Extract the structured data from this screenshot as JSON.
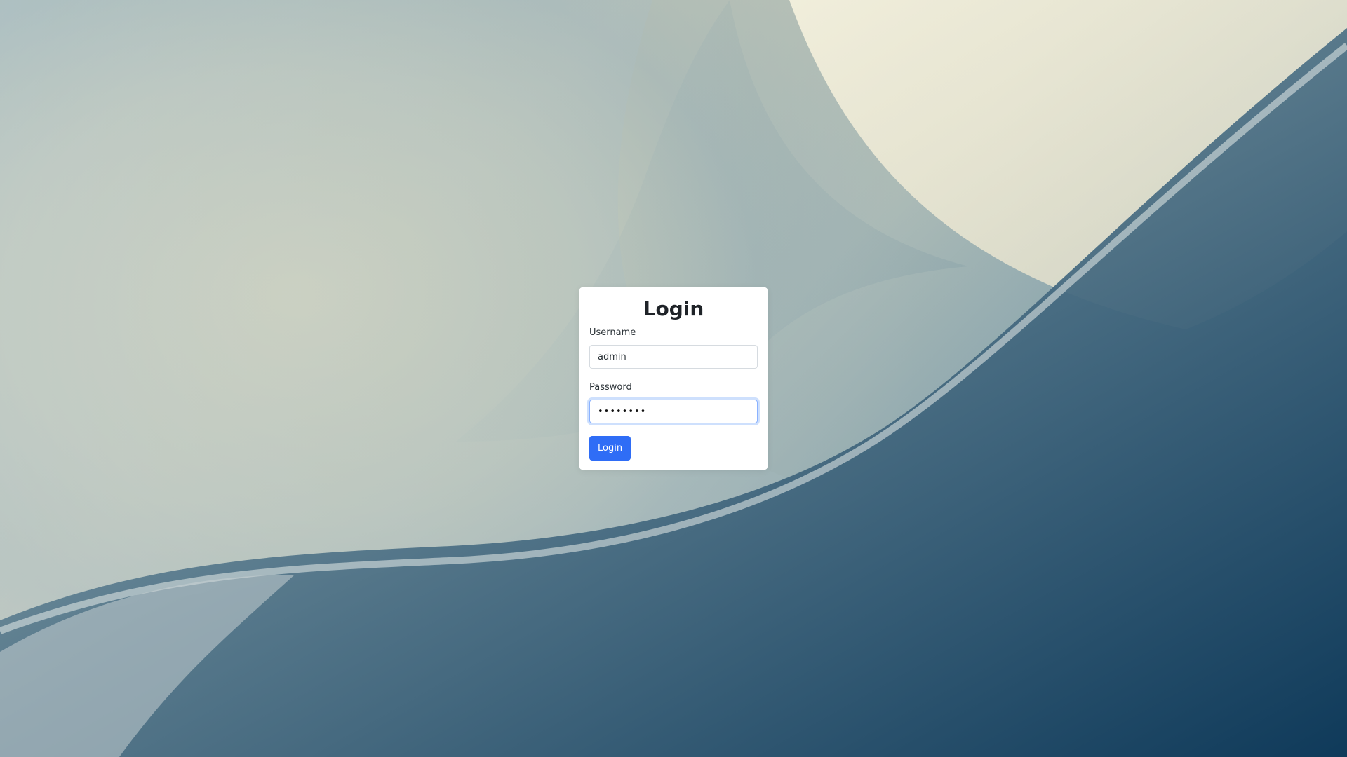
{
  "login": {
    "title": "Login",
    "username_label": "Username",
    "username_value": "admin",
    "password_label": "Password",
    "password_value": "••••••••",
    "submit_label": "Login"
  },
  "colors": {
    "button_bg": "#2f6df6",
    "focus_ring": "#8bb2ff"
  }
}
